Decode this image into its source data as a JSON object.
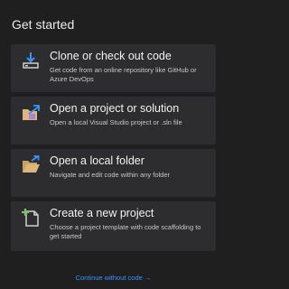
{
  "heading": "Get started",
  "cards": [
    {
      "title": "Clone or check out code",
      "description": "Get code from an online repository like GitHub or Azure DevOps",
      "icon": "clone-download-icon"
    },
    {
      "title": "Open a project or solution",
      "description": "Open a local Visual Studio project or .sln file",
      "icon": "open-project-icon"
    },
    {
      "title": "Open a local folder",
      "description": "Navigate and edit code within any folder",
      "icon": "open-folder-icon"
    },
    {
      "title": "Create a new project",
      "description": "Choose a project template with code scaffolding to get started",
      "icon": "new-project-icon"
    }
  ],
  "continue_link": "Continue without code →",
  "colors": {
    "background": "#1f1f1f",
    "card": "#2d2d30",
    "accent_blue": "#3794ff",
    "folder_yellow": "#dcb67a",
    "plus_green": "#7cc36c"
  }
}
